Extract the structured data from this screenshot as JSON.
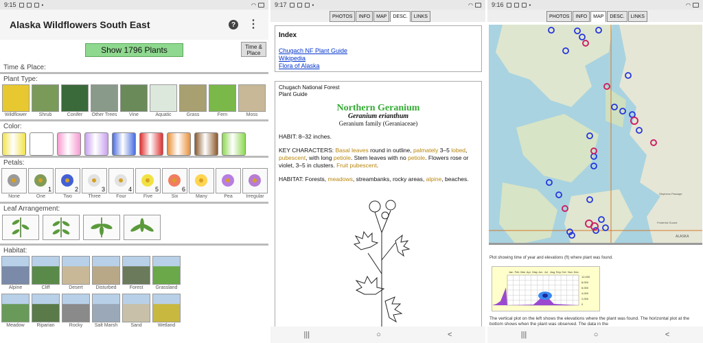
{
  "panel1": {
    "status_time": "9:15",
    "title": "Alaska Wildflowers South East",
    "show_button": "Show 1796 Plants",
    "time_place_button": [
      "Time &",
      "Place"
    ],
    "sections": {
      "time_place": "Time & Place:",
      "plant_type": "Plant Type:",
      "color": "Color:",
      "petals": "Petals:",
      "leaf": "Leaf Arrangement:",
      "habitat": "Habitat:"
    },
    "plant_types": [
      "Wildflower",
      "Shrub",
      "Conifer",
      "Other Trees",
      "Vine",
      "Aquatic",
      "Grass",
      "Fern",
      "Moss"
    ],
    "colors": [
      "#f2e34a",
      "#ffffff",
      "#f59ad0",
      "#c9a0f0",
      "#4a6de0",
      "#e03030",
      "#e8903a",
      "#8b5a2b",
      "#8ed850"
    ],
    "petals": [
      {
        "cap": "None",
        "num": ""
      },
      {
        "cap": "One",
        "num": "1"
      },
      {
        "cap": "Two",
        "num": "2"
      },
      {
        "cap": "Three",
        "num": "3"
      },
      {
        "cap": "Four",
        "num": "4"
      },
      {
        "cap": "Five",
        "num": "5"
      },
      {
        "cap": "Six",
        "num": "6"
      },
      {
        "cap": "Many",
        "num": ""
      },
      {
        "cap": "Pea",
        "num": ""
      },
      {
        "cap": "Irregular",
        "num": ""
      }
    ],
    "habitats_row1": [
      "Alpine",
      "Cliff",
      "Desert",
      "Disturbed",
      "Forest",
      "Grassland"
    ],
    "habitats_row2": [
      "Meadow",
      "Riparian",
      "Rocky",
      "Salt Marsh",
      "Sand",
      "Wetland"
    ]
  },
  "panel2": {
    "status_time": "9:17",
    "tabs": [
      "PHOTOS",
      "INFO",
      "MAP",
      "DESC.",
      "LINKS"
    ],
    "active_tab": "DESC.",
    "index_title": "Index",
    "links": [
      "Chugach NF Plant Guide",
      "Wikipedia",
      "Flora of Alaska"
    ],
    "source_line1": "Chugach National Forest",
    "source_line2": "Plant Guide",
    "common_name": "Northern Geranium",
    "scientific_name": "Geranium erianthum",
    "family": "Geranium family (Geraniaceae)",
    "habit": "HABIT: 8–32 inches.",
    "key_label": "KEY CHARACTERS: ",
    "key_parts": [
      {
        "t": "Basal leaves",
        "h": true
      },
      {
        "t": " round in outline, ",
        "h": false
      },
      {
        "t": "palmately",
        "h": true
      },
      {
        "t": " 3–5 ",
        "h": false
      },
      {
        "t": "lobed",
        "h": true
      },
      {
        "t": ", ",
        "h": false
      },
      {
        "t": "pubescent",
        "h": true
      },
      {
        "t": ", with long ",
        "h": false
      },
      {
        "t": "petiole",
        "h": true
      },
      {
        "t": ". Stem leaves with no ",
        "h": false
      },
      {
        "t": "petiole",
        "h": true
      },
      {
        "t": ". Flowers rose or violet, 3–5 in clusters. ",
        "h": false
      },
      {
        "t": "Fruit pubescent",
        "h": true
      },
      {
        "t": ".",
        "h": false
      }
    ],
    "habitat_parts": [
      {
        "t": "HABITAT: Forests, ",
        "h": false
      },
      {
        "t": "meadows",
        "h": true
      },
      {
        "t": ", streambanks, rocky areas, ",
        "h": false
      },
      {
        "t": "alpine",
        "h": true
      },
      {
        "t": ", beaches.",
        "h": false
      }
    ]
  },
  "panel3": {
    "status_time": "9:16",
    "tabs": [
      "PHOTOS",
      "INFO",
      "MAP",
      "DESC.",
      "LINKS"
    ],
    "active_tab": "MAP",
    "map_labels": [
      "ALASKA",
      "Stephens Passage",
      "Frederick Sound"
    ],
    "graph_note": "Plot showing time of year and elevations (ft) where plant was found.",
    "months": [
      "Jan",
      "Feb",
      "Mar",
      "Apr",
      "May",
      "Jun",
      "Jul",
      "Aug",
      "Sep",
      "Oct",
      "Nov",
      "Dec"
    ],
    "elevations": [
      "12,000",
      "8,000",
      "6,000",
      "4,000",
      "2,000",
      "0"
    ],
    "graph_text": "The vertical plot on the left shows the elevations where the plant was found. The horizontal plot at the bottom shows when the plant was observed. The data in the"
  },
  "nav": [
    "|||",
    "○",
    "<"
  ]
}
